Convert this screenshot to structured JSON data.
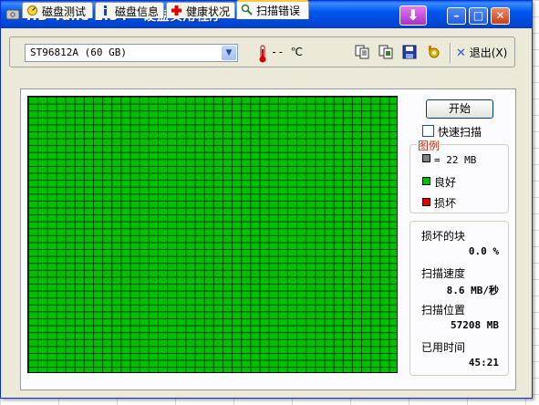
{
  "window": {
    "title": "HD Tune 2.54 - 硬盘实用程序",
    "download_glyph": "⬇",
    "minimize_glyph": "–",
    "maximize_glyph": "□",
    "close_glyph": "✕"
  },
  "toolbar": {
    "drive": "ST96812A (60 GB)",
    "temperature": "-- ℃",
    "exit_label": "退出(X)",
    "icons": [
      "copy-text-icon",
      "copy-screenshot-icon",
      "save-icon",
      "options-icon"
    ]
  },
  "tabs": [
    {
      "label": "磁盘测试",
      "icon": "benchmark-icon"
    },
    {
      "label": "磁盘信息",
      "icon": "info-icon"
    },
    {
      "label": "健康状况",
      "icon": "health-icon"
    },
    {
      "label": "扫描错误",
      "icon": "scan-icon",
      "active": true
    }
  ],
  "scan": {
    "start_label": "开始",
    "quick_scan_label": "快速扫描",
    "quick_scan_checked": false,
    "block_status": "all good"
  },
  "legend": {
    "title": "图例",
    "block_size": "= 22 MB",
    "good": "良好",
    "damaged": "损坏"
  },
  "stats": {
    "damaged_blocks_label": "损坏的块",
    "damaged_blocks_value": "0.0 %",
    "speed_label": "扫描速度",
    "speed_value": "8.6 MB/秒",
    "position_label": "扫描位置",
    "position_value": "57208 MB",
    "elapsed_label": "已用时间",
    "elapsed_value": "45:21"
  },
  "colors": {
    "good": "#00c000",
    "damaged": "#e00000",
    "block_unit": "#808080",
    "title_bar": "#0058ee",
    "legend_title": "#c03010"
  }
}
